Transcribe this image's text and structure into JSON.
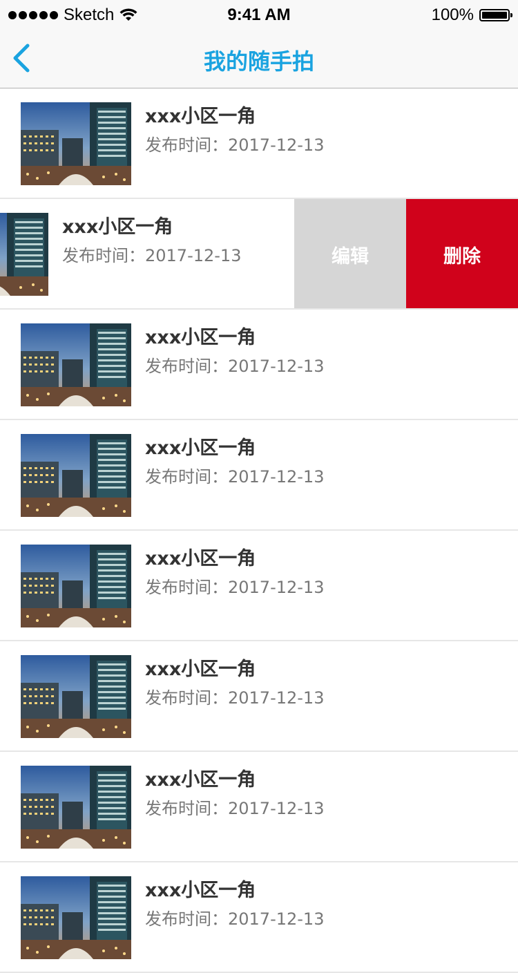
{
  "status_bar": {
    "carrier": "Sketch",
    "time": "9:41 AM",
    "battery": "100%",
    "icons": [
      "signal-dots-icon",
      "wifi-icon",
      "battery-icon"
    ]
  },
  "nav": {
    "title": "我的随手拍",
    "back_icon": "chevron-left-icon",
    "accent_color": "#1aa3e0"
  },
  "items": [
    {
      "title": "xxx小区一角",
      "date": "发布时间：2017-12-13",
      "thumb_icon": "building-photo"
    },
    {
      "title": "xxx小区一角",
      "date": "发布时间：2017-12-13",
      "thumb_icon": "building-photo",
      "swiped": true
    },
    {
      "title": "xxx小区一角",
      "date": "发布时间：2017-12-13",
      "thumb_icon": "building-photo"
    },
    {
      "title": "xxx小区一角",
      "date": "发布时间：2017-12-13",
      "thumb_icon": "building-photo"
    },
    {
      "title": "xxx小区一角",
      "date": "发布时间：2017-12-13",
      "thumb_icon": "building-photo"
    },
    {
      "title": "xxx小区一角",
      "date": "发布时间：2017-12-13",
      "thumb_icon": "building-photo"
    },
    {
      "title": "xxx小区一角",
      "date": "发布时间：2017-12-13",
      "thumb_icon": "building-photo"
    },
    {
      "title": "xxx小区一角",
      "date": "发布时间：2017-12-13",
      "thumb_icon": "building-photo"
    }
  ],
  "swipe_actions": {
    "edit_label": "编辑",
    "delete_label": "删除",
    "edit_color": "#d6d6d6",
    "delete_color": "#d0021b"
  }
}
